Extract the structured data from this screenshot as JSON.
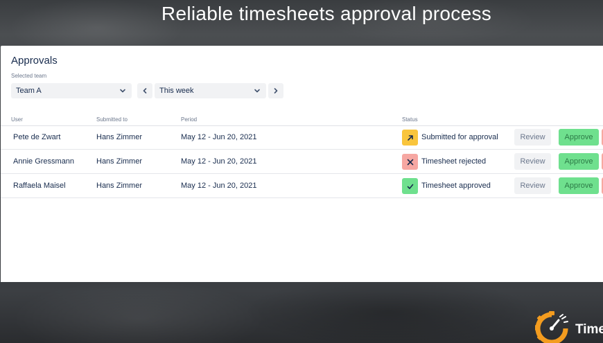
{
  "hero": {
    "title": "Reliable timesheets approval process"
  },
  "panel": {
    "title": "Approvals",
    "team_label": "Selected team",
    "team_select": {
      "value": "Team A"
    },
    "week_select": {
      "value": "This week"
    }
  },
  "table": {
    "columns": [
      "User",
      "Submitted to",
      "Period",
      "Status"
    ],
    "rows": [
      {
        "user": "Pete de Zwart",
        "submitted_to": "Hans Zimmer",
        "period": "May 12 - Jun 20, 2021",
        "status": "Submitted for approval",
        "status_icon": "arrow-up-right-icon",
        "status_color": "#f9c53c"
      },
      {
        "user": "Annie Gressmann",
        "submitted_to": "Hans Zimmer",
        "period": "May 12 - Jun 20, 2021",
        "status": "Timesheet rejected",
        "status_icon": "cross-icon",
        "status_color": "#f6a7a2"
      },
      {
        "user": "Raffaela Maisel",
        "submitted_to": "Hans Zimmer",
        "period": "May 12 - Jun 20, 2021",
        "status": "Timesheet approved",
        "status_icon": "check-icon",
        "status_color": "#6fe08e"
      }
    ],
    "actions": {
      "review": "Review",
      "approve": "Approve"
    }
  },
  "logo": {
    "text": "Time"
  },
  "colors": {
    "accent_orange": "#f39c1f",
    "approve_green": "#6fe08e",
    "reject_red": "#f8a8a0",
    "pending_yellow": "#f9c53c"
  }
}
